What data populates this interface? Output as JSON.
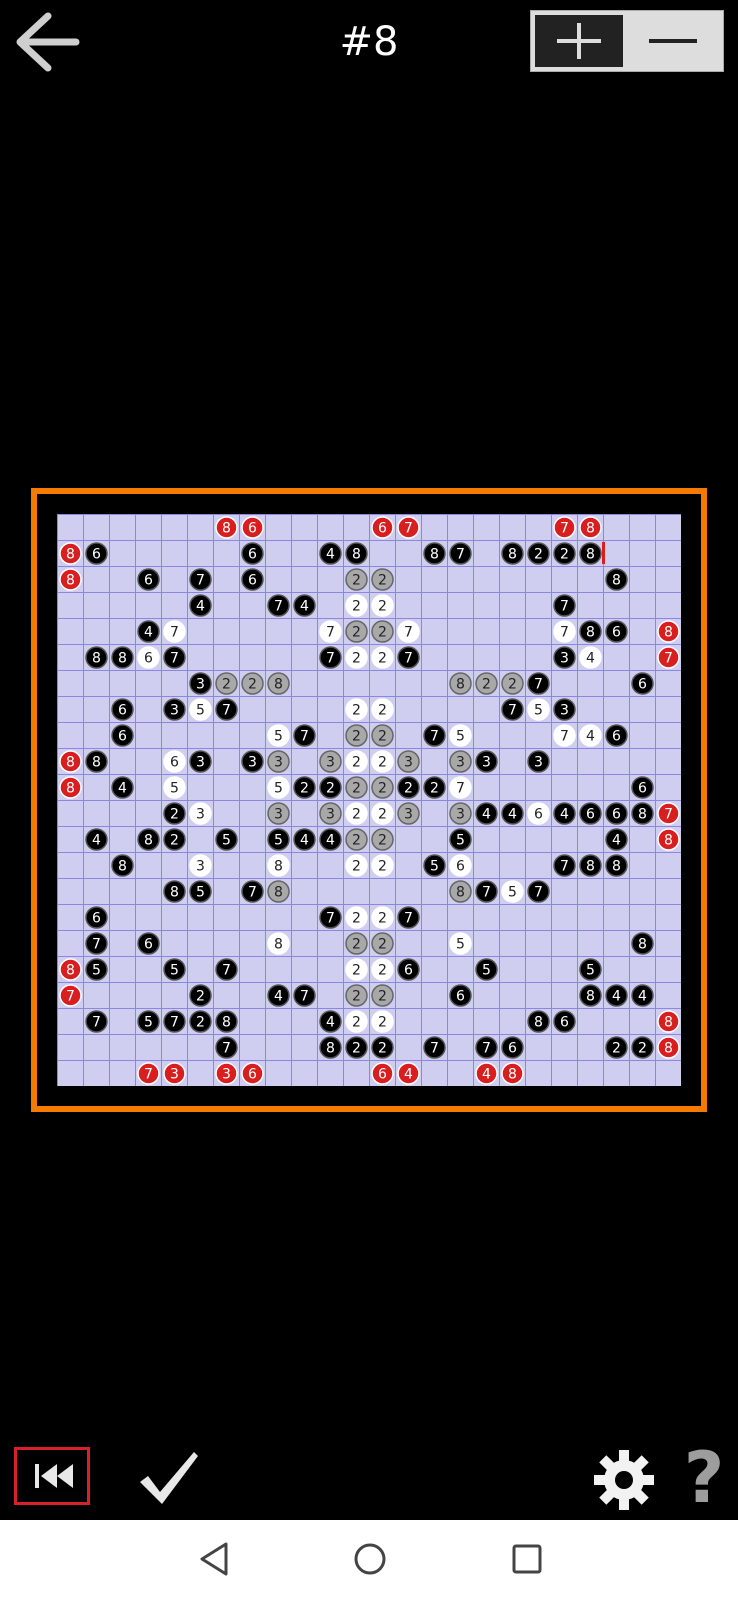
{
  "header": {
    "title": "#8"
  },
  "colors": {
    "frame": "#f47b00",
    "board_bg": "#cfcdf0",
    "grid": "#8a86e2",
    "black": "#000000",
    "red": "#d81e1e",
    "gray": "#a8a8a8",
    "white": "#ffffff"
  },
  "icons": {
    "back": "arrow-left-icon",
    "zoom_in": "plus-icon",
    "zoom_out": "minus-icon",
    "rewind": "rewind-icon",
    "check": "checkmark-icon",
    "settings": "gear-icon",
    "help": "question-mark-icon",
    "nav_back": "triangle-back-icon",
    "nav_home": "circle-home-icon",
    "nav_recent": "square-recent-icon"
  },
  "bottom": {
    "help_label": "?"
  },
  "board": {
    "rows": 22,
    "cols": 24,
    "cells": [
      [
        0,
        6,
        "8",
        "r"
      ],
      [
        0,
        7,
        "6",
        "r"
      ],
      [
        0,
        12,
        "6",
        "r"
      ],
      [
        0,
        13,
        "7",
        "r"
      ],
      [
        0,
        19,
        "7",
        "r"
      ],
      [
        0,
        20,
        "8",
        "r"
      ],
      [
        1,
        0,
        "8",
        "r"
      ],
      [
        1,
        1,
        "6",
        "b"
      ],
      [
        1,
        7,
        "6",
        "b"
      ],
      [
        1,
        10,
        "4",
        "b"
      ],
      [
        1,
        11,
        "8",
        "b"
      ],
      [
        1,
        14,
        "8",
        "b"
      ],
      [
        1,
        15,
        "7",
        "b"
      ],
      [
        1,
        17,
        "8",
        "b"
      ],
      [
        1,
        18,
        "2",
        "b"
      ],
      [
        1,
        19,
        "2",
        "b"
      ],
      [
        1,
        20,
        "8",
        "b"
      ],
      [
        2,
        0,
        "8",
        "r"
      ],
      [
        2,
        3,
        "6",
        "b"
      ],
      [
        2,
        5,
        "7",
        "b"
      ],
      [
        2,
        7,
        "6",
        "b"
      ],
      [
        2,
        11,
        "2",
        "g"
      ],
      [
        2,
        12,
        "2",
        "g"
      ],
      [
        2,
        21,
        "8",
        "b"
      ],
      [
        3,
        5,
        "4",
        "b"
      ],
      [
        3,
        8,
        "7",
        "b"
      ],
      [
        3,
        9,
        "4",
        "b"
      ],
      [
        3,
        11,
        "2",
        "w"
      ],
      [
        3,
        12,
        "2",
        "w"
      ],
      [
        3,
        19,
        "7",
        "b"
      ],
      [
        4,
        3,
        "4",
        "b"
      ],
      [
        4,
        4,
        "7",
        "w"
      ],
      [
        4,
        10,
        "7",
        "w"
      ],
      [
        4,
        11,
        "2",
        "g"
      ],
      [
        4,
        12,
        "2",
        "g"
      ],
      [
        4,
        13,
        "7",
        "w"
      ],
      [
        4,
        19,
        "7",
        "w"
      ],
      [
        4,
        20,
        "8",
        "b"
      ],
      [
        4,
        21,
        "6",
        "b"
      ],
      [
        4,
        23,
        "8",
        "r"
      ],
      [
        5,
        1,
        "8",
        "b"
      ],
      [
        5,
        2,
        "8",
        "b"
      ],
      [
        5,
        3,
        "6",
        "w"
      ],
      [
        5,
        4,
        "7",
        "b"
      ],
      [
        5,
        10,
        "7",
        "b"
      ],
      [
        5,
        11,
        "2",
        "w"
      ],
      [
        5,
        12,
        "2",
        "w"
      ],
      [
        5,
        13,
        "7",
        "b"
      ],
      [
        5,
        19,
        "3",
        "b"
      ],
      [
        5,
        20,
        "4",
        "w"
      ],
      [
        5,
        23,
        "7",
        "r"
      ],
      [
        6,
        5,
        "3",
        "b"
      ],
      [
        6,
        6,
        "2",
        "g"
      ],
      [
        6,
        7,
        "2",
        "g"
      ],
      [
        6,
        8,
        "8",
        "g"
      ],
      [
        6,
        15,
        "8",
        "g"
      ],
      [
        6,
        16,
        "2",
        "g"
      ],
      [
        6,
        17,
        "2",
        "g"
      ],
      [
        6,
        18,
        "7",
        "b"
      ],
      [
        6,
        22,
        "6",
        "b"
      ],
      [
        7,
        2,
        "6",
        "b"
      ],
      [
        7,
        4,
        "3",
        "b"
      ],
      [
        7,
        5,
        "5",
        "w"
      ],
      [
        7,
        6,
        "7",
        "b"
      ],
      [
        7,
        11,
        "2",
        "w"
      ],
      [
        7,
        12,
        "2",
        "w"
      ],
      [
        7,
        17,
        "7",
        "b"
      ],
      [
        7,
        18,
        "5",
        "w"
      ],
      [
        7,
        19,
        "3",
        "b"
      ],
      [
        8,
        2,
        "6",
        "b"
      ],
      [
        8,
        8,
        "5",
        "w"
      ],
      [
        8,
        9,
        "7",
        "b"
      ],
      [
        8,
        11,
        "2",
        "g"
      ],
      [
        8,
        12,
        "2",
        "g"
      ],
      [
        8,
        14,
        "7",
        "b"
      ],
      [
        8,
        15,
        "5",
        "w"
      ],
      [
        8,
        19,
        "7",
        "w"
      ],
      [
        8,
        20,
        "4",
        "w"
      ],
      [
        8,
        21,
        "6",
        "b"
      ],
      [
        9,
        0,
        "8",
        "r"
      ],
      [
        9,
        1,
        "8",
        "b"
      ],
      [
        9,
        4,
        "6",
        "w"
      ],
      [
        9,
        5,
        "3",
        "b"
      ],
      [
        9,
        7,
        "3",
        "b"
      ],
      [
        9,
        8,
        "3",
        "g"
      ],
      [
        9,
        10,
        "3",
        "g"
      ],
      [
        9,
        11,
        "2",
        "w"
      ],
      [
        9,
        12,
        "2",
        "w"
      ],
      [
        9,
        13,
        "3",
        "g"
      ],
      [
        9,
        15,
        "3",
        "g"
      ],
      [
        9,
        16,
        "3",
        "b"
      ],
      [
        9,
        18,
        "3",
        "b"
      ],
      [
        10,
        0,
        "8",
        "r"
      ],
      [
        10,
        2,
        "4",
        "b"
      ],
      [
        10,
        4,
        "5",
        "w"
      ],
      [
        10,
        8,
        "5",
        "w"
      ],
      [
        10,
        9,
        "2",
        "b"
      ],
      [
        10,
        10,
        "2",
        "b"
      ],
      [
        10,
        11,
        "2",
        "g"
      ],
      [
        10,
        12,
        "2",
        "g"
      ],
      [
        10,
        13,
        "2",
        "b"
      ],
      [
        10,
        14,
        "2",
        "b"
      ],
      [
        10,
        15,
        "7",
        "w"
      ],
      [
        10,
        22,
        "6",
        "b"
      ],
      [
        11,
        4,
        "2",
        "b"
      ],
      [
        11,
        5,
        "3",
        "w"
      ],
      [
        11,
        8,
        "3",
        "g"
      ],
      [
        11,
        10,
        "3",
        "g"
      ],
      [
        11,
        11,
        "2",
        "w"
      ],
      [
        11,
        12,
        "2",
        "w"
      ],
      [
        11,
        13,
        "3",
        "g"
      ],
      [
        11,
        15,
        "3",
        "g"
      ],
      [
        11,
        16,
        "4",
        "b"
      ],
      [
        11,
        17,
        "4",
        "b"
      ],
      [
        11,
        18,
        "6",
        "w"
      ],
      [
        11,
        19,
        "4",
        "b"
      ],
      [
        11,
        20,
        "6",
        "b"
      ],
      [
        11,
        21,
        "6",
        "b"
      ],
      [
        11,
        22,
        "8",
        "b"
      ],
      [
        11,
        23,
        "7",
        "r"
      ],
      [
        12,
        1,
        "4",
        "b"
      ],
      [
        12,
        3,
        "8",
        "b"
      ],
      [
        12,
        4,
        "2",
        "b"
      ],
      [
        12,
        6,
        "5",
        "b"
      ],
      [
        12,
        8,
        "5",
        "b"
      ],
      [
        12,
        9,
        "4",
        "b"
      ],
      [
        12,
        10,
        "4",
        "b"
      ],
      [
        12,
        11,
        "2",
        "g"
      ],
      [
        12,
        12,
        "2",
        "g"
      ],
      [
        12,
        15,
        "5",
        "b"
      ],
      [
        12,
        21,
        "4",
        "b"
      ],
      [
        12,
        23,
        "8",
        "r"
      ],
      [
        13,
        2,
        "8",
        "b"
      ],
      [
        13,
        5,
        "3",
        "w"
      ],
      [
        13,
        8,
        "8",
        "w"
      ],
      [
        13,
        11,
        "2",
        "w"
      ],
      [
        13,
        12,
        "2",
        "w"
      ],
      [
        13,
        14,
        "5",
        "b"
      ],
      [
        13,
        15,
        "6",
        "w"
      ],
      [
        13,
        19,
        "7",
        "b"
      ],
      [
        13,
        20,
        "8",
        "b"
      ],
      [
        13,
        21,
        "8",
        "b"
      ],
      [
        14,
        4,
        "8",
        "b"
      ],
      [
        14,
        5,
        "5",
        "b"
      ],
      [
        14,
        7,
        "7",
        "b"
      ],
      [
        14,
        8,
        "8",
        "g"
      ],
      [
        14,
        15,
        "8",
        "g"
      ],
      [
        14,
        16,
        "7",
        "b"
      ],
      [
        14,
        17,
        "5",
        "w"
      ],
      [
        14,
        18,
        "7",
        "b"
      ],
      [
        15,
        1,
        "6",
        "b"
      ],
      [
        15,
        10,
        "7",
        "b"
      ],
      [
        15,
        11,
        "2",
        "w"
      ],
      [
        15,
        12,
        "2",
        "w"
      ],
      [
        15,
        13,
        "7",
        "b"
      ],
      [
        16,
        1,
        "7",
        "b"
      ],
      [
        16,
        3,
        "6",
        "b"
      ],
      [
        16,
        8,
        "8",
        "w"
      ],
      [
        16,
        11,
        "2",
        "g"
      ],
      [
        16,
        12,
        "2",
        "g"
      ],
      [
        16,
        15,
        "5",
        "w"
      ],
      [
        16,
        22,
        "8",
        "b"
      ],
      [
        17,
        0,
        "8",
        "r"
      ],
      [
        17,
        1,
        "5",
        "b"
      ],
      [
        17,
        4,
        "5",
        "b"
      ],
      [
        17,
        6,
        "7",
        "b"
      ],
      [
        17,
        11,
        "2",
        "w"
      ],
      [
        17,
        12,
        "2",
        "w"
      ],
      [
        17,
        13,
        "6",
        "b"
      ],
      [
        17,
        16,
        "5",
        "b"
      ],
      [
        17,
        20,
        "5",
        "b"
      ],
      [
        18,
        0,
        "7",
        "r"
      ],
      [
        18,
        5,
        "2",
        "b"
      ],
      [
        18,
        8,
        "4",
        "b"
      ],
      [
        18,
        9,
        "7",
        "b"
      ],
      [
        18,
        11,
        "2",
        "g"
      ],
      [
        18,
        12,
        "2",
        "g"
      ],
      [
        18,
        15,
        "6",
        "b"
      ],
      [
        18,
        20,
        "8",
        "b"
      ],
      [
        18,
        21,
        "4",
        "b"
      ],
      [
        18,
        22,
        "4",
        "b"
      ],
      [
        19,
        1,
        "7",
        "b"
      ],
      [
        19,
        3,
        "5",
        "b"
      ],
      [
        19,
        4,
        "7",
        "b"
      ],
      [
        19,
        5,
        "2",
        "b"
      ],
      [
        19,
        6,
        "8",
        "b"
      ],
      [
        19,
        10,
        "4",
        "b"
      ],
      [
        19,
        11,
        "2",
        "w"
      ],
      [
        19,
        12,
        "2",
        "w"
      ],
      [
        19,
        18,
        "8",
        "b"
      ],
      [
        19,
        19,
        "6",
        "b"
      ],
      [
        19,
        23,
        "8",
        "r"
      ],
      [
        20,
        6,
        "7",
        "b"
      ],
      [
        20,
        10,
        "8",
        "b"
      ],
      [
        20,
        11,
        "2",
        "b"
      ],
      [
        20,
        12,
        "2",
        "b"
      ],
      [
        20,
        14,
        "7",
        "b"
      ],
      [
        20,
        16,
        "7",
        "b"
      ],
      [
        20,
        17,
        "6",
        "b"
      ],
      [
        20,
        21,
        "2",
        "b"
      ],
      [
        20,
        22,
        "2",
        "b"
      ],
      [
        20,
        23,
        "8",
        "r"
      ],
      [
        21,
        3,
        "7",
        "r"
      ],
      [
        21,
        4,
        "3",
        "r"
      ],
      [
        21,
        6,
        "3",
        "r"
      ],
      [
        21,
        7,
        "6",
        "r"
      ],
      [
        21,
        12,
        "6",
        "r"
      ],
      [
        21,
        13,
        "4",
        "r"
      ],
      [
        21,
        16,
        "4",
        "r"
      ],
      [
        21,
        17,
        "8",
        "r"
      ]
    ]
  }
}
